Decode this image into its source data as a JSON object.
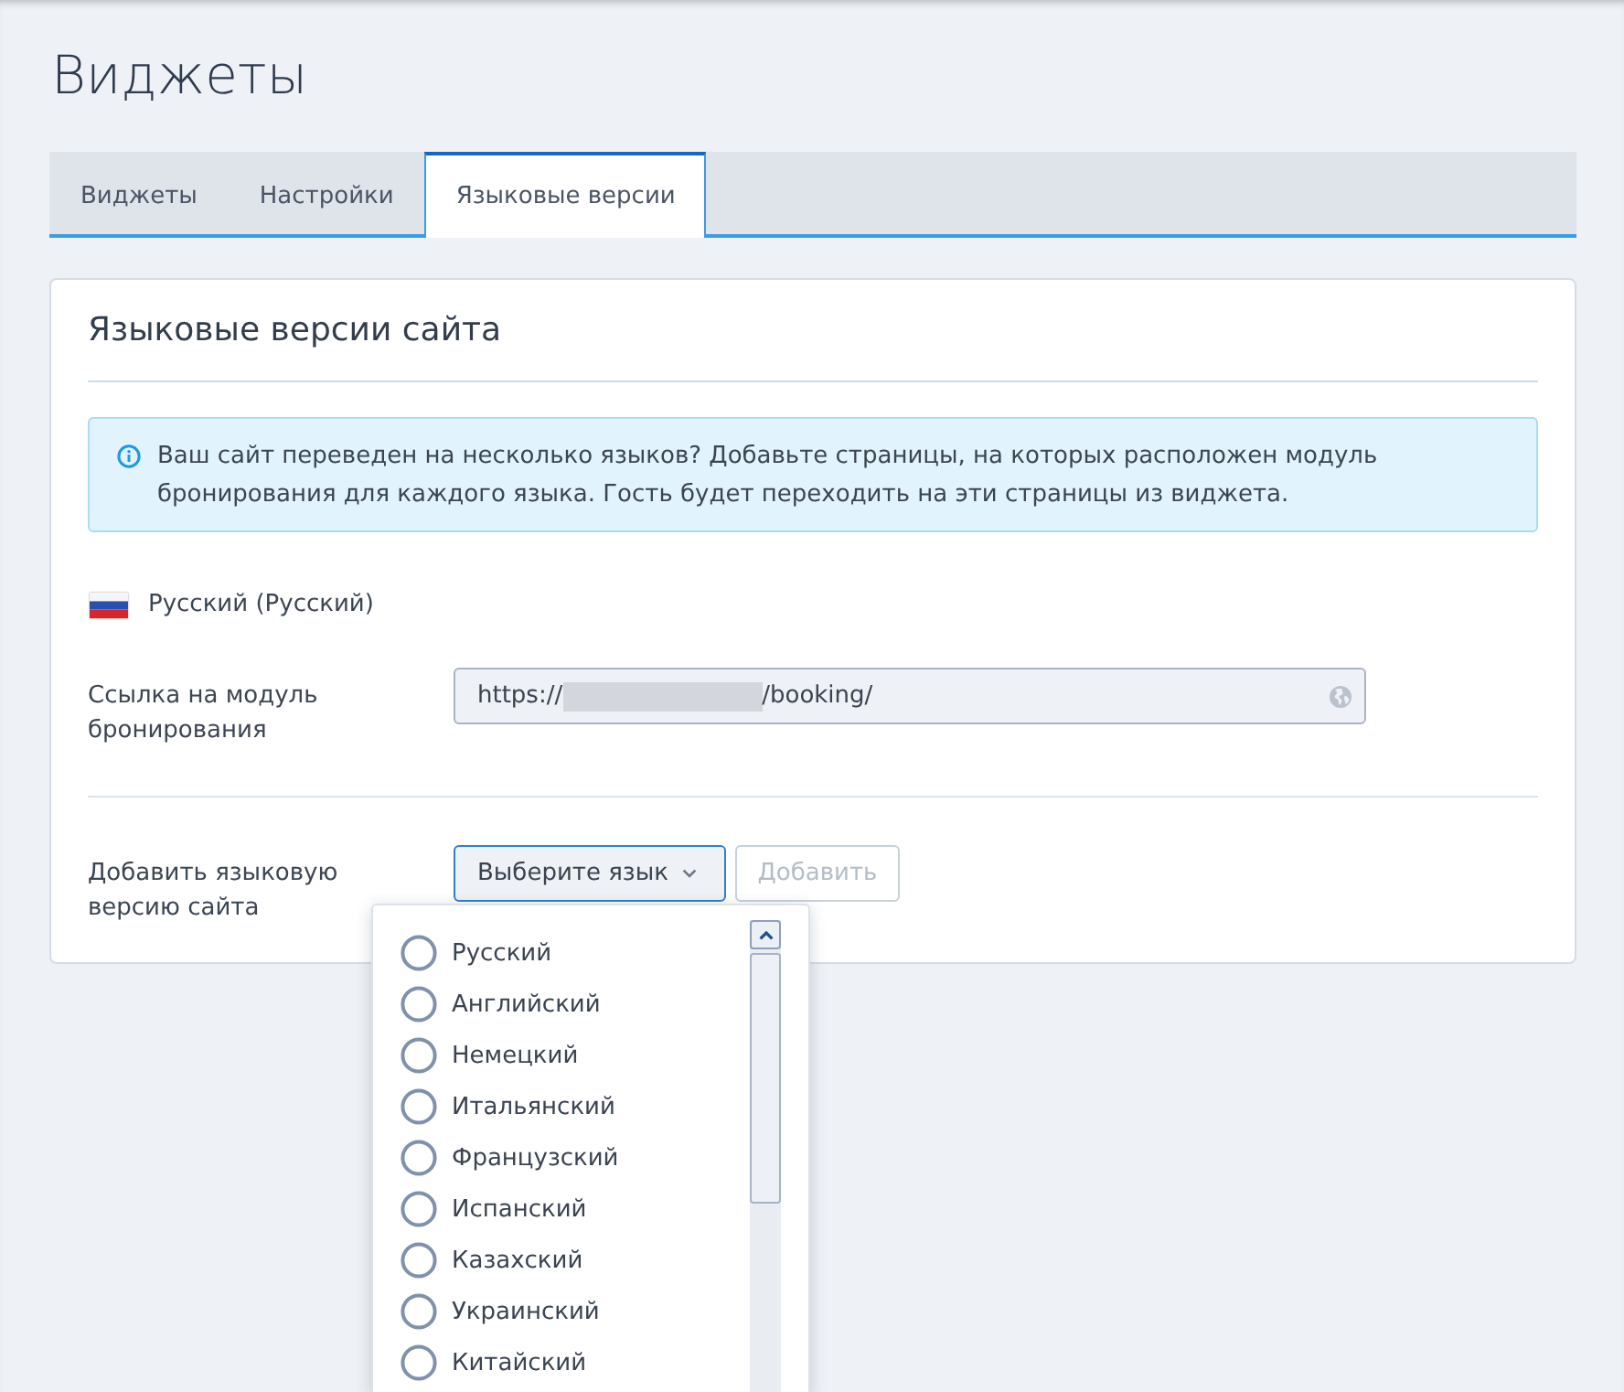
{
  "page_title": "Виджеты",
  "tabs": [
    {
      "label": "Виджеты",
      "selected": false
    },
    {
      "label": "Настройки",
      "selected": false
    },
    {
      "label": "Языковые версии",
      "selected": true
    }
  ],
  "card": {
    "title": "Языковые версии сайта",
    "info": "Ваш сайт переведен на несколько языков? Добавьте страницы, на которых расположен модуль бронирования для каждого языка. Гость будет переходить на эти страницы из виджета.",
    "languages": [
      {
        "name": "Русский (Русский)",
        "link_label": "Ссылка на модуль бронирования",
        "url_start": "https://",
        "url_end": "/booking/",
        "redacted": true
      }
    ],
    "add_label": "Добавить языковую версию сайта",
    "select": {
      "label": "Выберите язык",
      "open": true,
      "options": [
        {
          "label": "Русский",
          "selected": false
        },
        {
          "label": "Английский",
          "selected": false
        },
        {
          "label": "Немецкий",
          "selected": false
        },
        {
          "label": "Итальянский",
          "selected": false
        },
        {
          "label": "Французский",
          "selected": false
        },
        {
          "label": "Испанский",
          "selected": false
        },
        {
          "label": "Казахский",
          "selected": false
        },
        {
          "label": "Украинский",
          "selected": false
        },
        {
          "label": "Китайский",
          "selected": false
        }
      ]
    },
    "add_button": {
      "label": "Добавить",
      "disabled": true
    }
  }
}
